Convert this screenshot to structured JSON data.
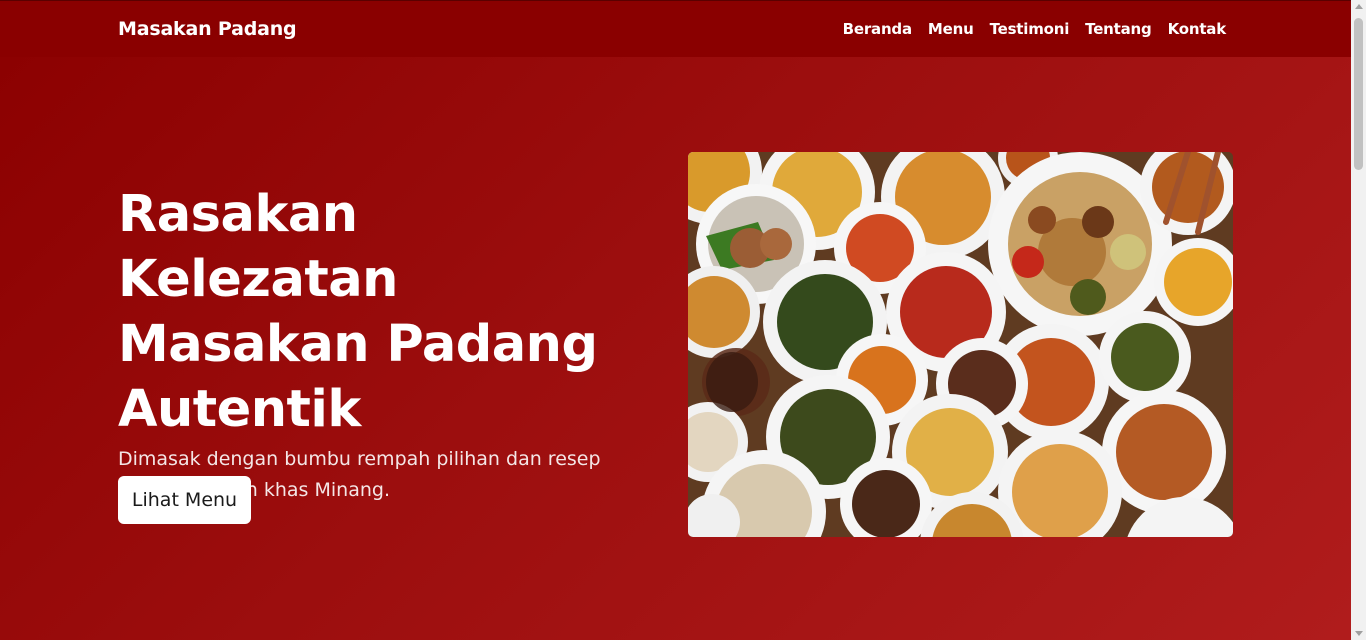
{
  "navbar": {
    "brand": "Masakan Padang",
    "links": [
      "Beranda",
      "Menu",
      "Testimoni",
      "Tentang",
      "Kontak"
    ]
  },
  "hero": {
    "title_lines": [
      "Rasakan Kelezatan",
      "Masakan Padang",
      "Autentik"
    ],
    "subtitle": "Dimasak dengan bumbu rempah pilihan dan resep turun-temurun khas Minang.",
    "cta_label": "Lihat Menu",
    "image_alt": "Hidangan masakan Padang"
  },
  "colors": {
    "primary": "#8b0000",
    "accent": "#b01c1c",
    "button_bg": "#ffffff"
  }
}
